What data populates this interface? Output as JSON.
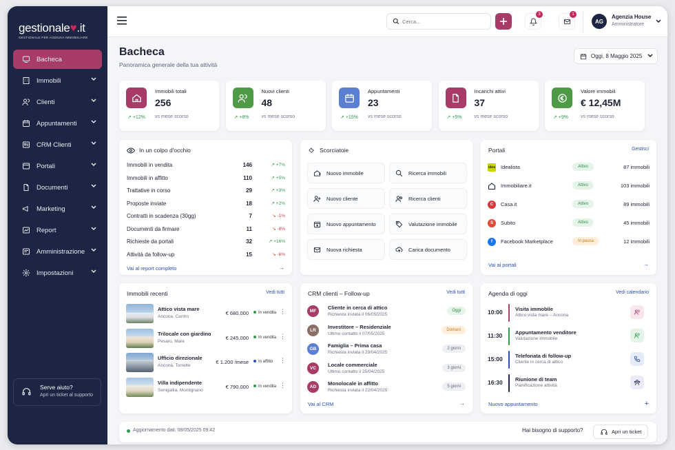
{
  "brand": {
    "name": "gestionale",
    "suffix": ".it",
    "tagline": "GESTIONALE PER AGENZIA IMMOBILIARE"
  },
  "sidebar": {
    "items": [
      {
        "label": "Bacheca",
        "icon": "dashboard-icon"
      },
      {
        "label": "Immobili",
        "icon": "building-icon"
      },
      {
        "label": "Clienti",
        "icon": "users-icon"
      },
      {
        "label": "Appuntamenti",
        "icon": "calendar-icon"
      },
      {
        "label": "CRM Clienti",
        "icon": "crm-icon"
      },
      {
        "label": "Portali",
        "icon": "portal-icon"
      },
      {
        "label": "Documenti",
        "icon": "document-icon"
      },
      {
        "label": "Marketing",
        "icon": "megaphone-icon"
      },
      {
        "label": "Report",
        "icon": "report-icon"
      },
      {
        "label": "Amministrazione",
        "icon": "admin-icon"
      },
      {
        "label": "Impostazioni",
        "icon": "gear-icon"
      }
    ],
    "help": {
      "title": "Serve aiuto?",
      "subtitle": "Apri un ticket al supporto"
    }
  },
  "topbar": {
    "search_placeholder": "Cerca...",
    "notifications_count": "3",
    "messages_count": "1",
    "user": {
      "initials": "AG",
      "name": "Agenzia House",
      "role": "Amministratore"
    }
  },
  "page": {
    "title": "Bacheca",
    "subtitle": "Panoramica generale della tua attività",
    "date": "Oggi, 8 Maggio 2025"
  },
  "stats": [
    {
      "label": "Immobili totali",
      "value": "256",
      "change": "+12%",
      "compare": "vs mese scorso",
      "color": "#a63c67"
    },
    {
      "label": "Nuovi clienti",
      "value": "48",
      "change": "+8%",
      "compare": "vs mese scorso",
      "color": "#4f9a47"
    },
    {
      "label": "Appuntamenti",
      "value": "23",
      "change": "+15%",
      "compare": "vs mese scorso",
      "color": "#5b7fd1"
    },
    {
      "label": "Incarichi attivi",
      "value": "37",
      "change": "+5%",
      "compare": "vs mese scorso",
      "color": "#a63c67"
    },
    {
      "label": "Valore immobili",
      "value": "€ 12,45M",
      "change": "+9%",
      "compare": "vs mese scorso",
      "color": "#4f9a47"
    }
  ],
  "overview": {
    "title": "In un colpo d'occhio",
    "rows": [
      {
        "name": "Immobili in vendita",
        "value": "146",
        "change": "+7%",
        "dir": "up"
      },
      {
        "name": "Immobili in affitto",
        "value": "110",
        "change": "+5%",
        "dir": "up"
      },
      {
        "name": "Trattative in corso",
        "value": "29",
        "change": "+3%",
        "dir": "up"
      },
      {
        "name": "Proposte inviate",
        "value": "18",
        "change": "+2%",
        "dir": "up"
      },
      {
        "name": "Contratti in scadenza (30gg)",
        "value": "7",
        "change": "-1%",
        "dir": "down"
      },
      {
        "name": "Documenti da firmare",
        "value": "11",
        "change": "-8%",
        "dir": "down"
      },
      {
        "name": "Richieste da portali",
        "value": "32",
        "change": "+16%",
        "dir": "up"
      },
      {
        "name": "Attività da follow-up",
        "value": "15",
        "change": "-6%",
        "dir": "down"
      }
    ],
    "link": "Vai al report completo"
  },
  "shortcuts": {
    "title": "Scorciatoie",
    "items": [
      {
        "label": "Nuovo immobile",
        "icon": "house-plus-icon"
      },
      {
        "label": "Ricerca immobili",
        "icon": "search-icon"
      },
      {
        "label": "Nuovo cliente",
        "icon": "user-plus-icon"
      },
      {
        "label": "Ricerca clienti",
        "icon": "users-search-icon"
      },
      {
        "label": "Nuovo appuntamento",
        "icon": "calendar-plus-icon"
      },
      {
        "label": "Valutazione immobile",
        "icon": "tag-icon"
      },
      {
        "label": "Nuova richiesta",
        "icon": "mail-icon"
      },
      {
        "label": "Carica documento",
        "icon": "upload-icon"
      }
    ]
  },
  "portals": {
    "title": "Portali",
    "manage": "Gestisci",
    "rows": [
      {
        "name": "Idealista",
        "logo": "idea",
        "status": "Attivo",
        "count": "87 immobili",
        "color": "#c8d400"
      },
      {
        "name": "Immobiliare.it",
        "logo": "house",
        "status": "Attivo",
        "count": "103 immobili",
        "color": "#1c2544"
      },
      {
        "name": "Casa.it",
        "logo": "C",
        "status": "Attivo",
        "count": "89 immobili",
        "color": "#d43a3a"
      },
      {
        "name": "Subito",
        "logo": "S",
        "status": "Attivo",
        "count": "45 immobili",
        "color": "#e24a3b"
      },
      {
        "name": "Facebook Marketplace",
        "logo": "f",
        "status": "In pausa",
        "count": "12 immobili",
        "color": "#1877f2"
      }
    ],
    "link": "Vai ai portali"
  },
  "recent": {
    "title": "Immobili recenti",
    "link": "Vedi tutti",
    "rows": [
      {
        "title": "Attico vista mare",
        "place": "Ancona, Centro",
        "price": "€ 680.000",
        "status": "In vendita",
        "dot": "#2e9a4d"
      },
      {
        "title": "Trilocale con giardino",
        "place": "Pesaro, Mare",
        "price": "€ 245.000",
        "status": "In vendita",
        "dot": "#2e9a4d"
      },
      {
        "title": "Ufficio direzionale",
        "place": "Ancona, Torrette",
        "price": "€ 1.200 /mese",
        "status": "In affitto",
        "dot": "#2b4fb5"
      },
      {
        "title": "Villa indipendente",
        "place": "Senigallia, Montignano",
        "price": "€ 790.000",
        "status": "In vendita",
        "dot": "#2e9a4d"
      }
    ]
  },
  "crm": {
    "title": "CRM clienti – Follow-up",
    "link": "Vedi tutti",
    "rows": [
      {
        "initials": "MF",
        "title": "Cliente in cerca di attico",
        "sub": "Richiesta inviata il 06/05/2025",
        "badge": "Oggi",
        "tone": "green",
        "color": "#a63c67"
      },
      {
        "initials": "LR",
        "title": "Investitore – Residenziale",
        "sub": "Ultimo contatto il 07/05/2025",
        "badge": "Domani",
        "tone": "orange",
        "color": "#8a6f64"
      },
      {
        "initials": "GB",
        "title": "Famiglia – Prima casa",
        "sub": "Richiesta inviata il 29/04/2025",
        "badge": "2 giorni",
        "tone": "gray",
        "color": "#5b7fd1"
      },
      {
        "initials": "VC",
        "title": "Locale commerciale",
        "sub": "Ultimo contatto il 25/04/2025",
        "badge": "3 giorni",
        "tone": "gray",
        "color": "#a63c67"
      },
      {
        "initials": "AD",
        "title": "Monolocale in affitto",
        "sub": "Richiesta inviata il 22/04/2025",
        "badge": "5 giorni",
        "tone": "gray",
        "color": "#a63c67"
      }
    ],
    "footer": "Vai al CRM"
  },
  "agenda": {
    "title": "Agenda di oggi",
    "link": "Vedi calendario",
    "rows": [
      {
        "time": "10:00",
        "title": "Visita immobile",
        "sub": "Attico vista mare – Ancona",
        "color": "#a63c67",
        "icon": "people-icon"
      },
      {
        "time": "11:30",
        "title": "Appuntamento venditore",
        "sub": "Valutazione immobile",
        "color": "#2e9a4d",
        "icon": "people-icon"
      },
      {
        "time": "15:00",
        "title": "Telefonata di follow-up",
        "sub": "Cliente in cerca di attico",
        "color": "#2b4fb5",
        "icon": "phone-icon"
      },
      {
        "time": "16:30",
        "title": "Riunione di team",
        "sub": "Pianificazione attività",
        "color": "#1c2544",
        "icon": "team-icon"
      }
    ],
    "footer": "Nuovo appuntamento"
  },
  "footer": {
    "updated": "Aggiornamento dati: 08/05/2025 09:42",
    "question": "Hai bisogno di supporto?",
    "ticket": "Apri un ticket"
  }
}
